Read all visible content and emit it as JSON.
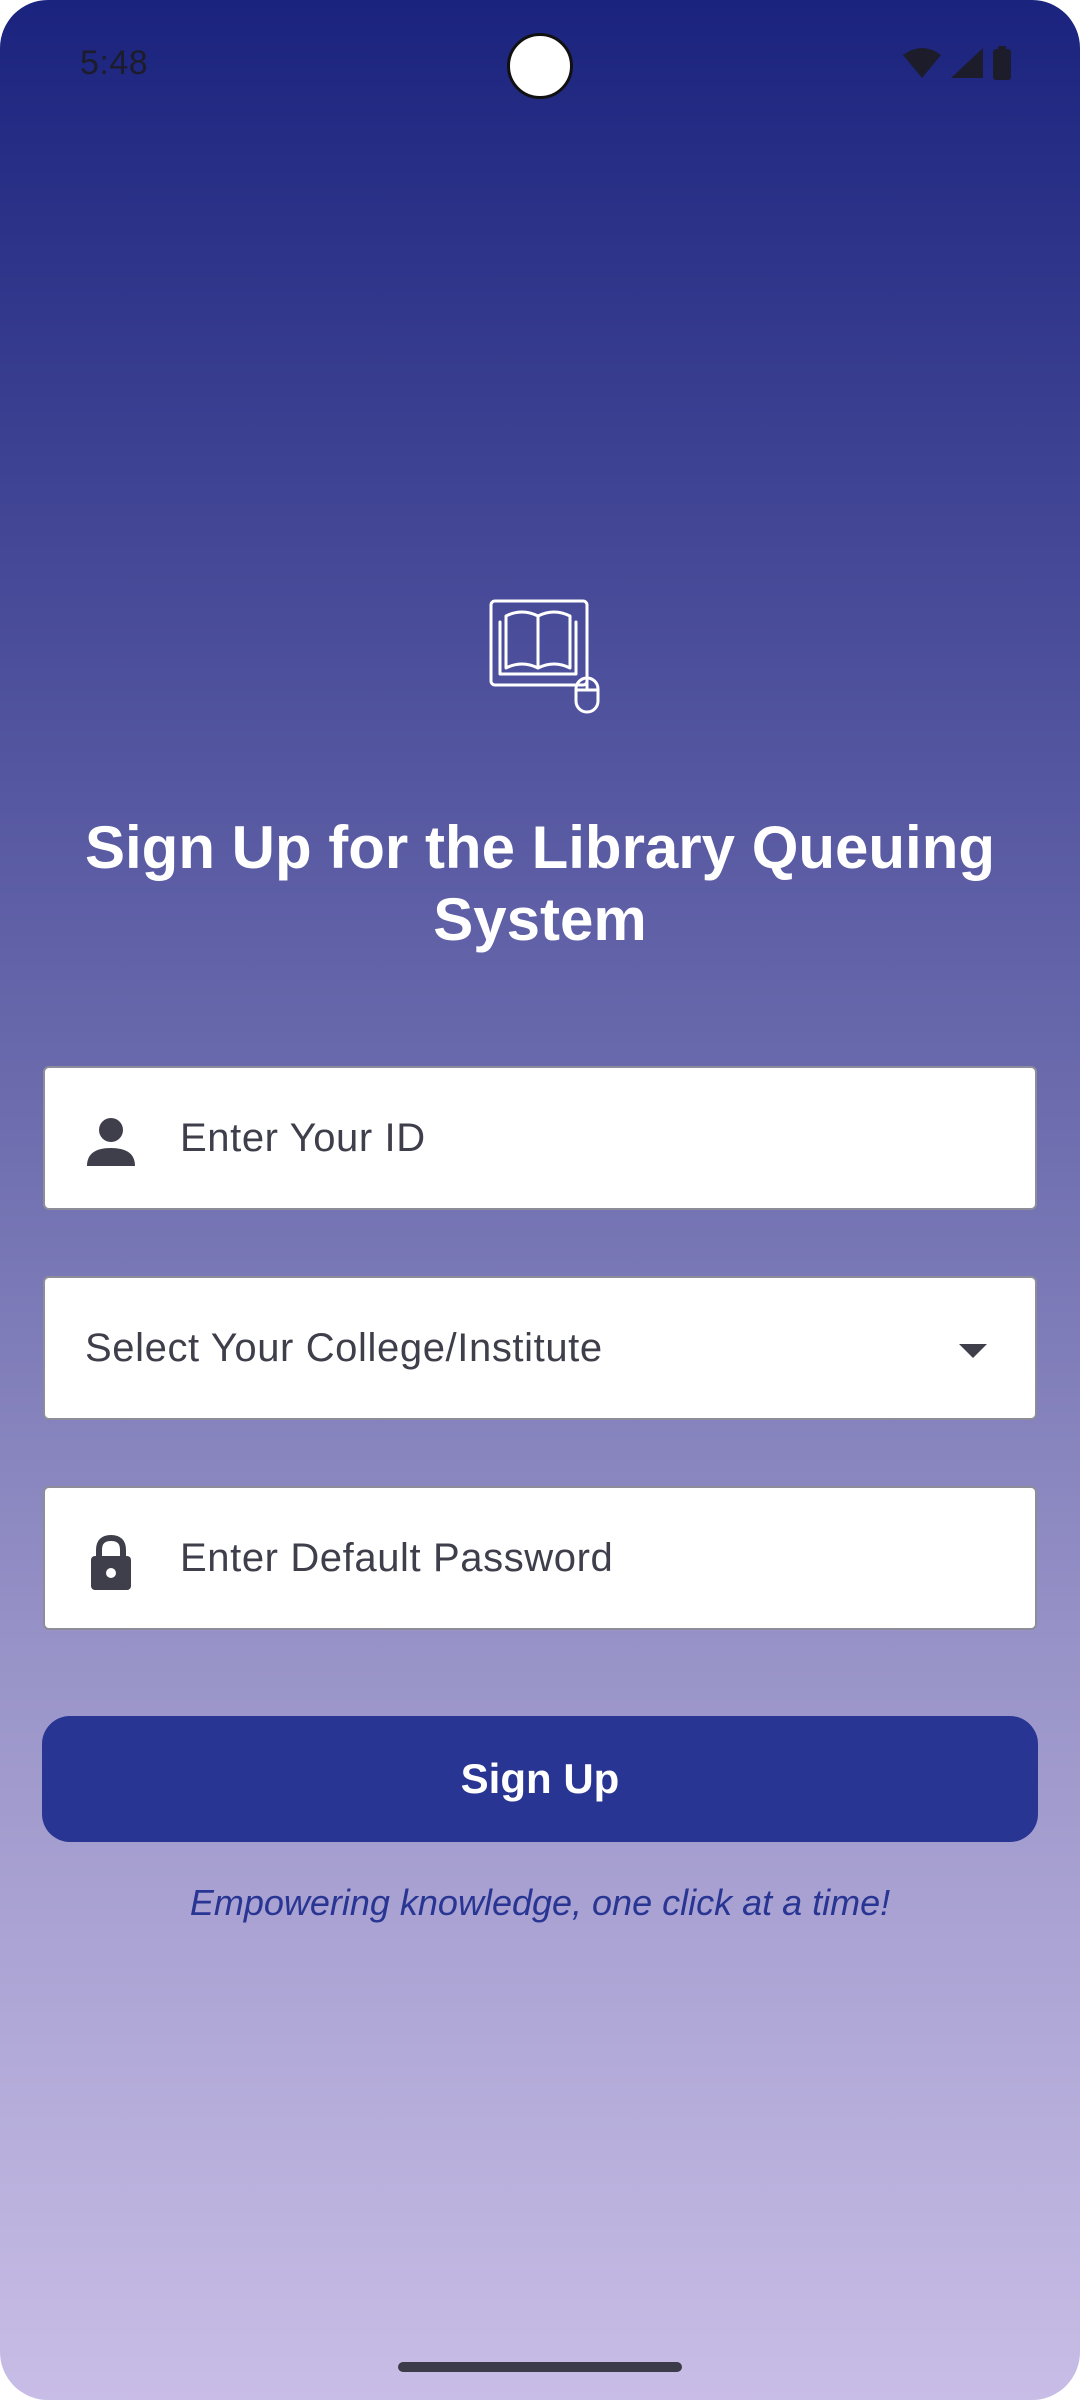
{
  "status_bar": {
    "time": "5:48",
    "icons": [
      "wifi-icon",
      "signal-icon",
      "battery-icon"
    ]
  },
  "logo": {
    "icon": "book-mouse-icon"
  },
  "title": "Sign Up for the Library Queuing System",
  "form": {
    "id_field": {
      "icon": "person-icon",
      "placeholder": "Enter Your ID"
    },
    "college_select": {
      "placeholder": "Select Your College/Institute",
      "icon": "dropdown-arrow-icon"
    },
    "password_field": {
      "icon": "lock-icon",
      "placeholder": "Enter Default Password"
    },
    "submit_label": "Sign Up"
  },
  "tagline": "Empowering knowledge, one click at a time!",
  "colors": {
    "gradient_top": "#1a237e",
    "gradient_bottom": "#c8bde6",
    "button": "#283593",
    "tagline": "#283593",
    "field_background": "#ffffff"
  }
}
